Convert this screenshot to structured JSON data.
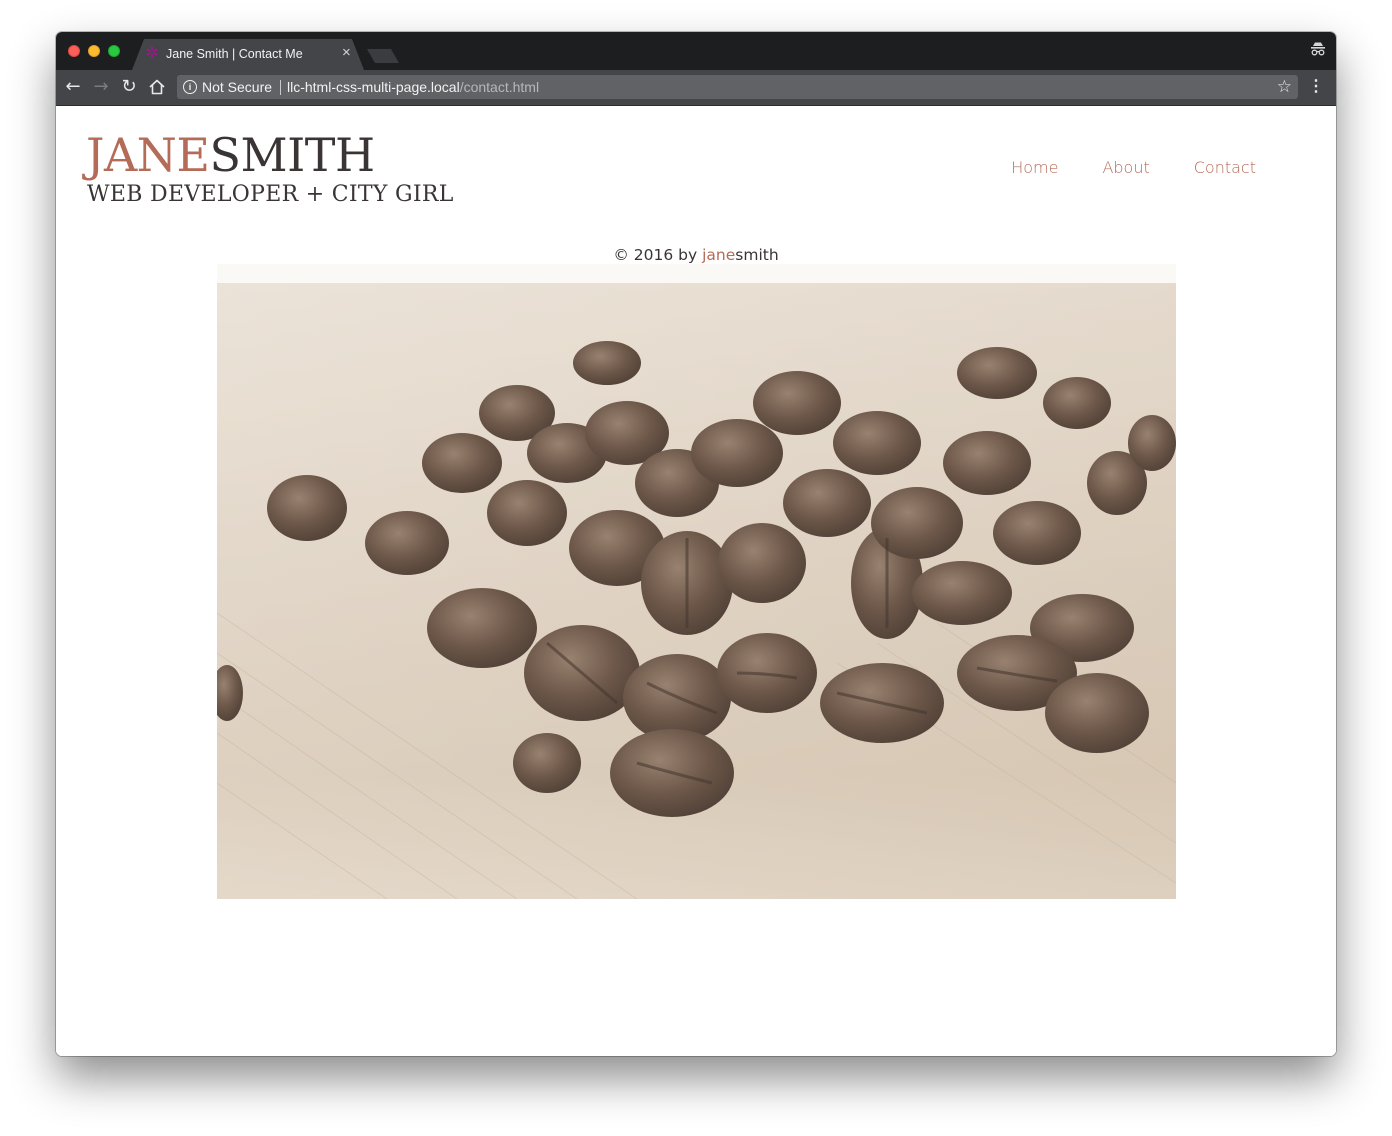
{
  "browser": {
    "tab_title": "Jane Smith | Contact Me",
    "tab_close": "×",
    "security_label": "Not Secure",
    "url_host": "llc-html-css-multi-page.local",
    "url_path": "/contact.html"
  },
  "icons": {
    "back": "back-arrow-icon",
    "forward": "forward-arrow-icon",
    "reload": "reload-icon",
    "home": "home-icon",
    "info": "info-icon",
    "star": "star-icon",
    "menu": "menu-icon",
    "incognito": "incognito-icon",
    "favicon": "favicon-icon"
  },
  "site": {
    "logo_first": "JANE",
    "logo_last": "SMITH",
    "tagline": "WEB DEVELOPER + CITY GIRL",
    "nav": [
      {
        "label": "Home"
      },
      {
        "label": "About"
      },
      {
        "label": "Contact"
      }
    ],
    "footer_prefix": "© 2016 by ",
    "footer_jane": "jane",
    "footer_smith": "smith"
  },
  "colors": {
    "accent": "#b46b57",
    "text": "#3a3434",
    "tab_strip": "#1d1e20",
    "toolbar": "#444549"
  }
}
